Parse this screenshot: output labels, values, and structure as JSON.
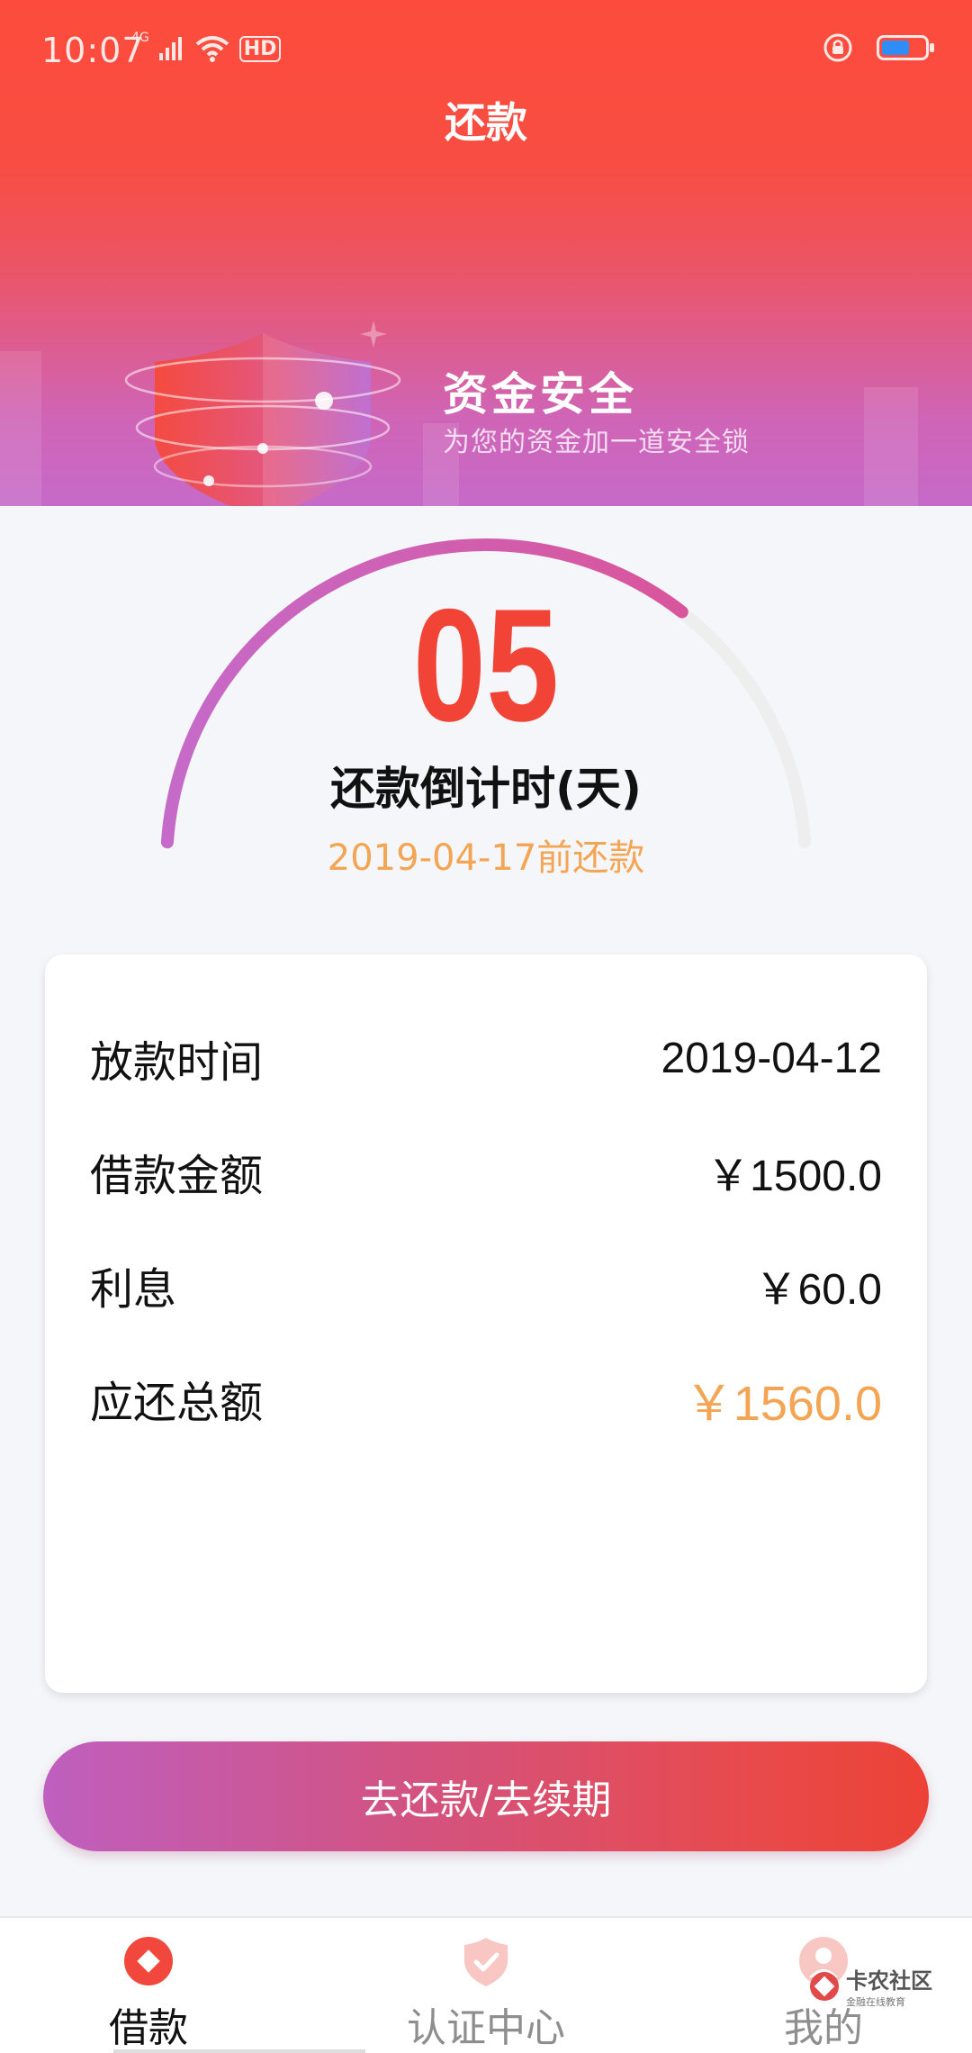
{
  "status_bar": {
    "time": "10:07",
    "network": "4G",
    "hd": "HD",
    "battery_level": 0.65
  },
  "header": {
    "title": "还款",
    "banner_title": "资金安全",
    "banner_subtitle": "为您的资金加一道安全锁"
  },
  "countdown": {
    "days": "05",
    "label": "还款倒计时(天)",
    "due_text": "2019-04-17前还款",
    "progress": 0.72
  },
  "details": {
    "rows": [
      {
        "label": "放款时间",
        "value": "2019-04-12"
      },
      {
        "label": "借款金额",
        "value": "￥1500.0"
      },
      {
        "label": "利息",
        "value": "￥60.0"
      },
      {
        "label": "应还总额",
        "value": "￥1560.0"
      }
    ]
  },
  "action": {
    "button_label": "去还款/去续期"
  },
  "nav": {
    "items": [
      {
        "label": "借款",
        "icon": "loan-icon",
        "active": true
      },
      {
        "label": "认证中心",
        "icon": "shield-check-icon",
        "active": false
      },
      {
        "label": "我的",
        "icon": "profile-icon",
        "active": false
      }
    ]
  },
  "watermark": {
    "text": "卡农社区",
    "sub": "金融在线教育"
  },
  "colors": {
    "header_top": "#fd4c3d",
    "header_bottom": "#c66ac9",
    "countdown": "#f24436",
    "accent_orange": "#f3a553",
    "button_start": "#bf5fbf",
    "button_end": "#ec4236"
  }
}
